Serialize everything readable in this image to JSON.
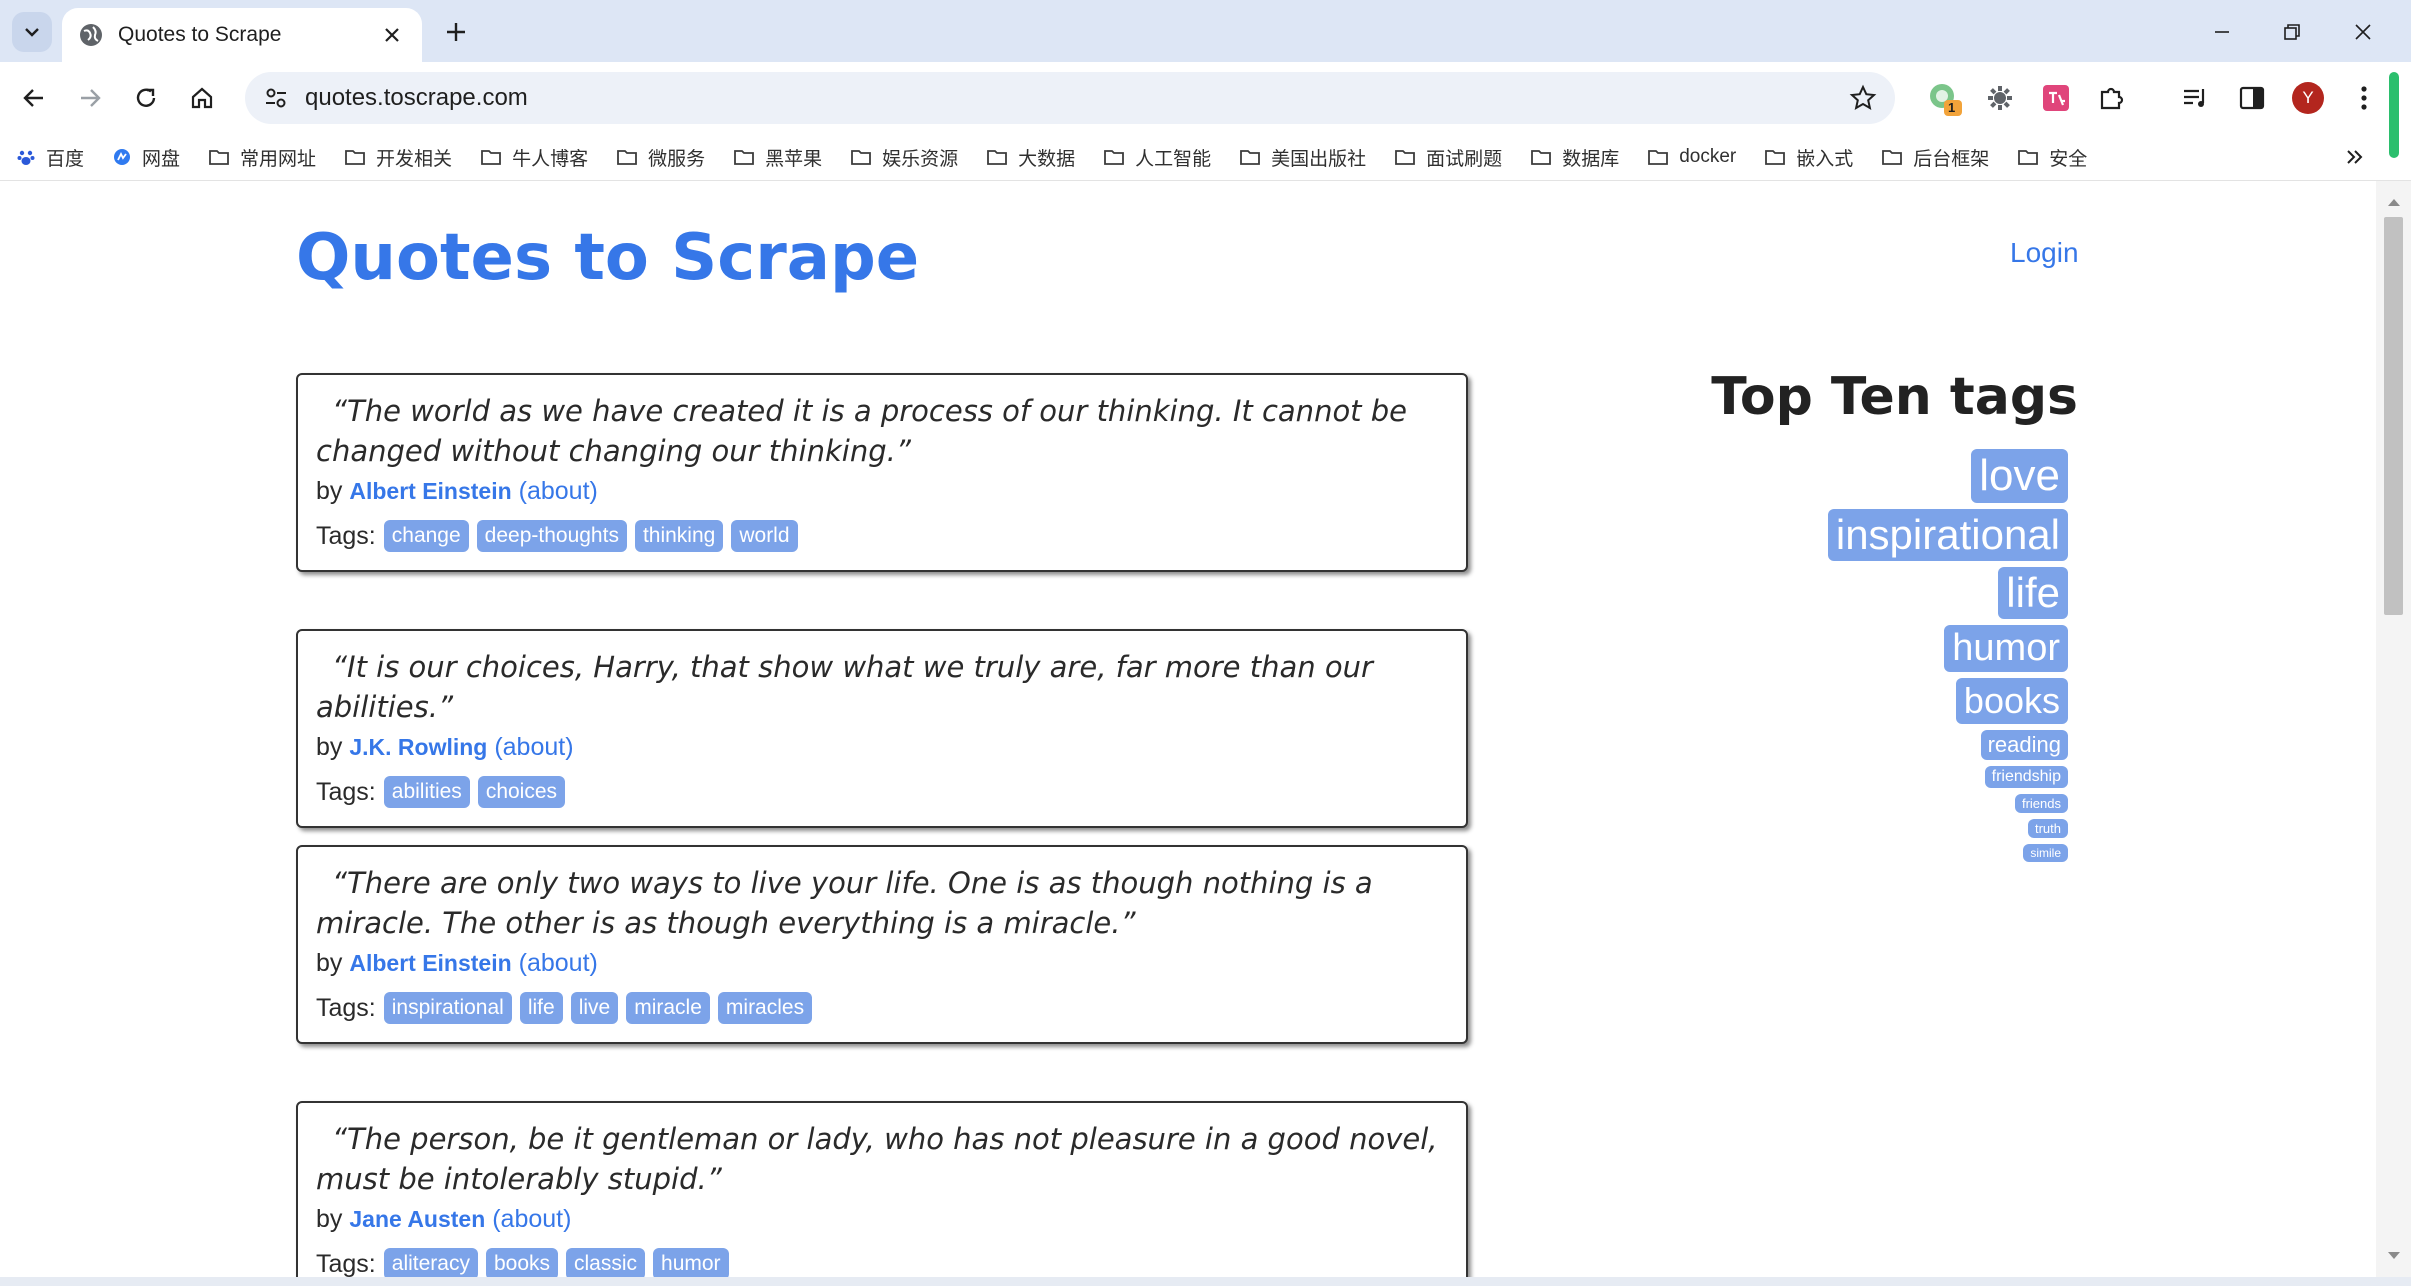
{
  "browser": {
    "tab_title": "Quotes to Scrape",
    "url": "quotes.toscrape.com",
    "profile_initial": "Y",
    "extension_badge": "1",
    "bookmarks": [
      "百度",
      "网盘",
      "常用网址",
      "开发相关",
      "牛人博客",
      "微服务",
      "黑苹果",
      "娱乐资源",
      "大数据",
      "人工智能",
      "美国出版社",
      "面试刷题",
      "数据库",
      "docker",
      "嵌入式",
      "后台框架",
      "安全"
    ]
  },
  "page": {
    "site_title": "Quotes to Scrape",
    "login_label": "Login",
    "by_label": "by",
    "about_label": "(about)",
    "tags_label": "Tags:",
    "quotes": [
      {
        "text": "“The world as we have created it is a process of our thinking. It cannot be changed without changing our thinking.”",
        "author": "Albert Einstein",
        "tags": [
          "change",
          "deep-thoughts",
          "thinking",
          "world"
        ]
      },
      {
        "text": "“It is our choices, Harry, that show what we truly are, far more than our abilities.”",
        "author": "J.K. Rowling",
        "tags": [
          "abilities",
          "choices"
        ]
      },
      {
        "text": "“There are only two ways to live your life. One is as though nothing is a miracle. The other is as though everything is a miracle.”",
        "author": "Albert Einstein",
        "tags": [
          "inspirational",
          "life",
          "live",
          "miracle",
          "miracles"
        ]
      },
      {
        "text": "“The person, be it gentleman or lady, who has not pleasure in a good novel, must be intolerably stupid.”",
        "author": "Jane Austen",
        "tags": [
          "aliteracy",
          "books",
          "classic",
          "humor"
        ]
      }
    ],
    "top_tags_title": "Top Ten tags",
    "top_tags": [
      "love",
      "inspirational",
      "life",
      "humor",
      "books",
      "reading",
      "friendship",
      "friends",
      "truth",
      "simile"
    ]
  },
  "colors": {
    "accent": "#3677e8",
    "tag_bg": "#7ca3e9",
    "tabstrip": "#dde6f5"
  }
}
